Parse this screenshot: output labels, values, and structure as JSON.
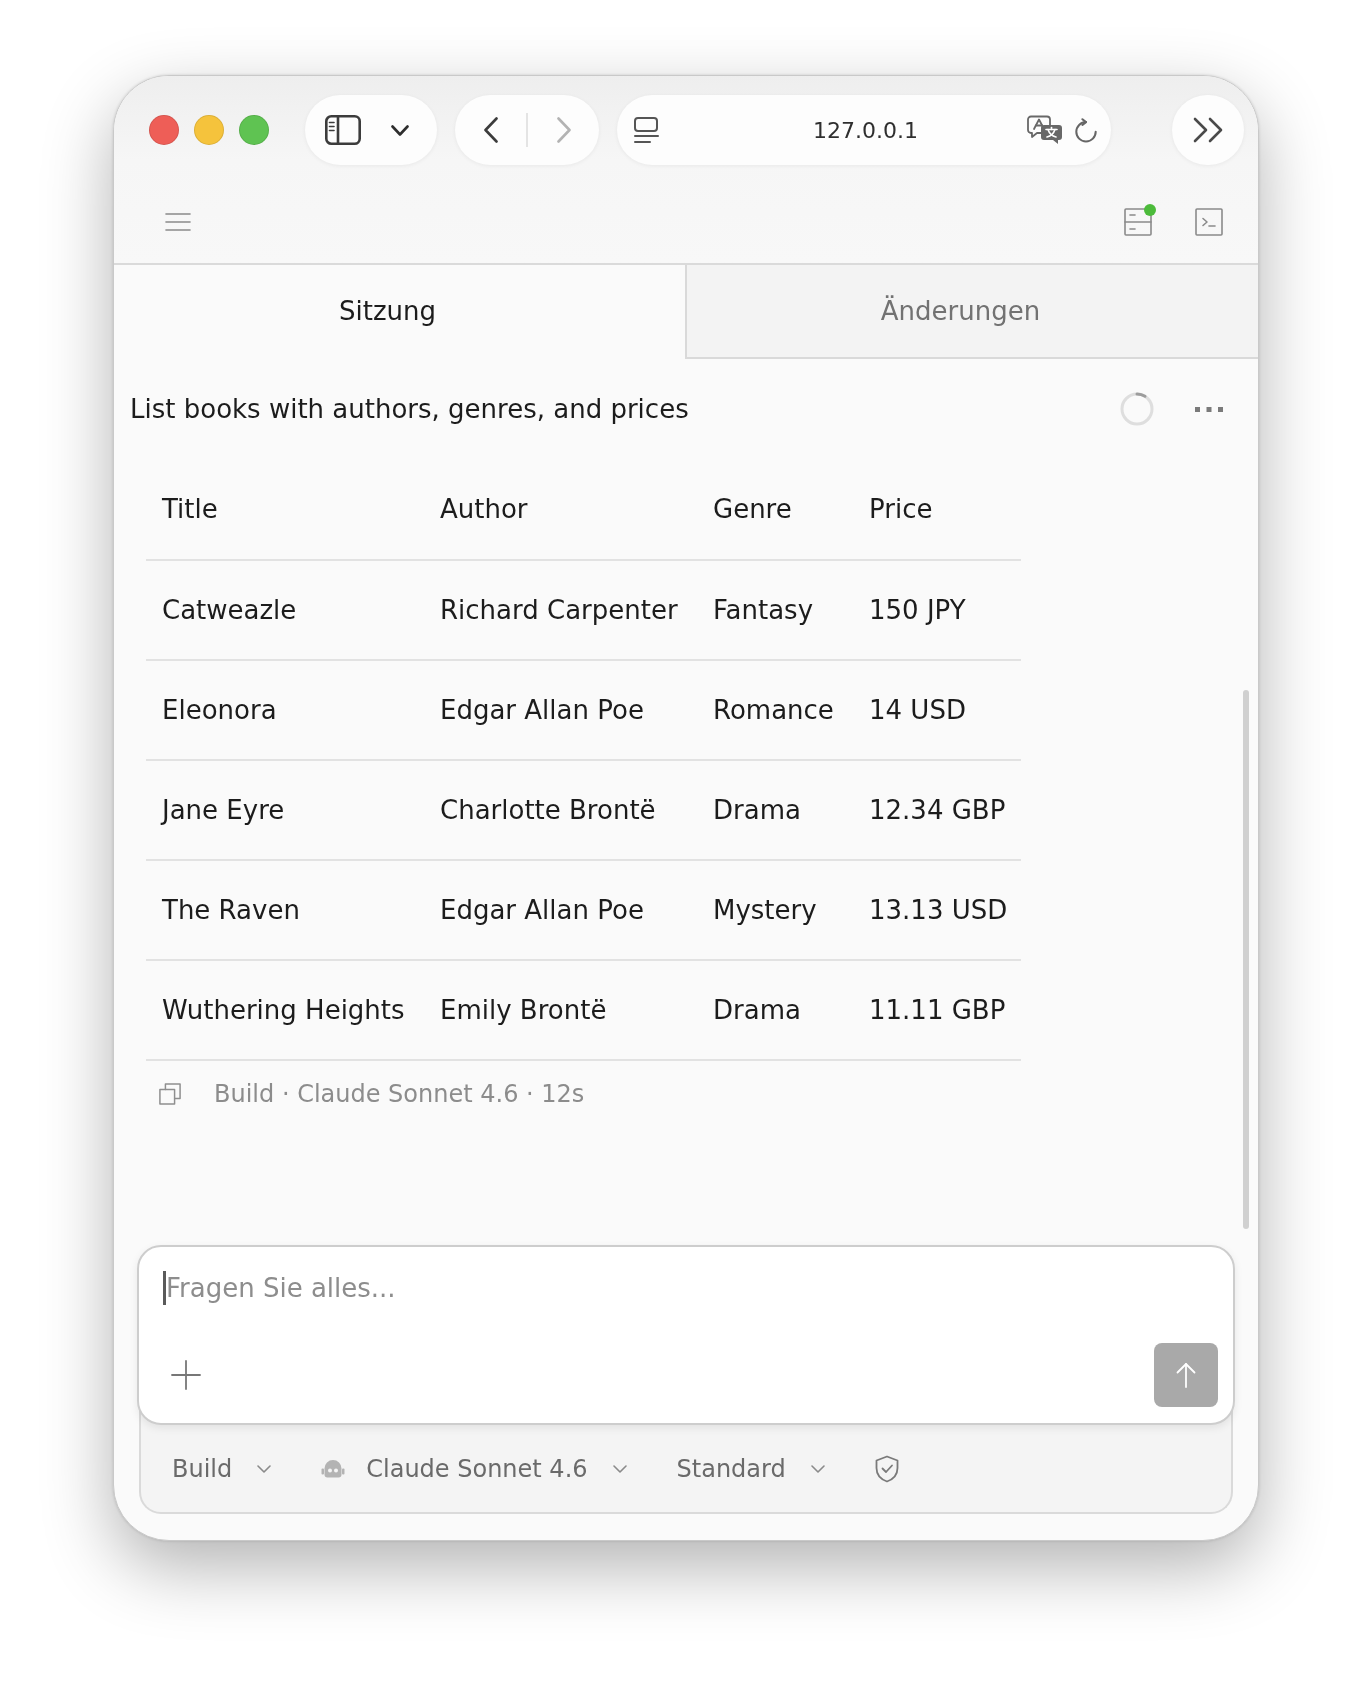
{
  "browser": {
    "address": "127.0.0.1",
    "back": {
      "disabled": false
    },
    "forward": {
      "disabled": true
    }
  },
  "toolbar": {
    "panel_badge": true
  },
  "tabs": [
    {
      "label": "Sitzung",
      "selected": true
    },
    {
      "label": "Änderungen",
      "selected": false
    }
  ],
  "session": {
    "title": "List books with authors, genres, and prices",
    "loading": true
  },
  "table": {
    "columns": [
      "Title",
      "Author",
      "Genre",
      "Price"
    ],
    "rows": [
      [
        "Catweazle",
        "Richard Carpenter",
        "Fantasy",
        "150 JPY"
      ],
      [
        "Eleonora",
        "Edgar Allan Poe",
        "Romance",
        "14 USD"
      ],
      [
        "Jane Eyre",
        "Charlotte Brontë",
        "Drama",
        "12.34 GBP"
      ],
      [
        "The Raven",
        "Edgar Allan Poe",
        "Mystery",
        "13.13 USD"
      ],
      [
        "Wuthering Heights",
        "Emily Brontë",
        "Drama",
        "11.11 GBP"
      ]
    ]
  },
  "message_meta": "Build · Claude Sonnet 4.6 · 12s",
  "composer": {
    "placeholder": "Fragen Sie alles...",
    "send_disabled": true
  },
  "options": [
    {
      "kind": "dropdown",
      "label": "Build"
    },
    {
      "kind": "model",
      "label": "Claude Sonnet 4.6"
    },
    {
      "kind": "dropdown",
      "label": "Standard"
    },
    {
      "kind": "shield"
    }
  ]
}
